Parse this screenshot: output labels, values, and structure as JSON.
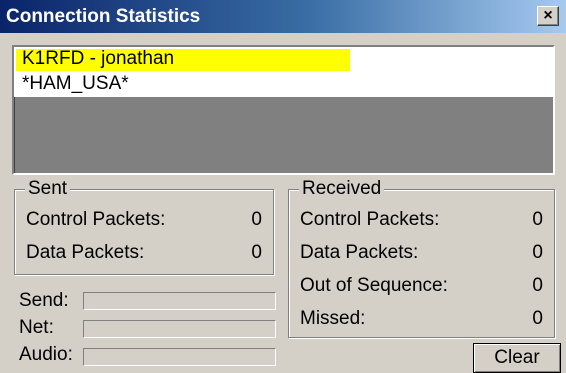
{
  "window": {
    "title": "Connection Statistics",
    "close_glyph": "×"
  },
  "connections": [
    {
      "label": "K1RFD - jonathan",
      "highlight": "#ffff00"
    },
    {
      "label": "*HAM_USA*",
      "highlight": null
    }
  ],
  "sent": {
    "title": "Sent",
    "rows": [
      {
        "label": "Control Packets:",
        "value": "0"
      },
      {
        "label": "Data Packets:",
        "value": "0"
      }
    ]
  },
  "received": {
    "title": "Received",
    "rows": [
      {
        "label": "Control Packets:",
        "value": "0"
      },
      {
        "label": "Data Packets:",
        "value": "0"
      },
      {
        "label": "Out of Sequence:",
        "value": "0"
      },
      {
        "label": "Missed:",
        "value": "0"
      }
    ]
  },
  "meters": [
    {
      "label": "Send:",
      "level": 0
    },
    {
      "label": "Net:",
      "level": 0
    },
    {
      "label": "Audio:",
      "level": 0
    }
  ],
  "buttons": {
    "clear": "Clear"
  },
  "colors": {
    "title_gradient_start": "#0a246a",
    "highlight": "#ffff00",
    "dialog_bg": "#d4d0c8"
  }
}
